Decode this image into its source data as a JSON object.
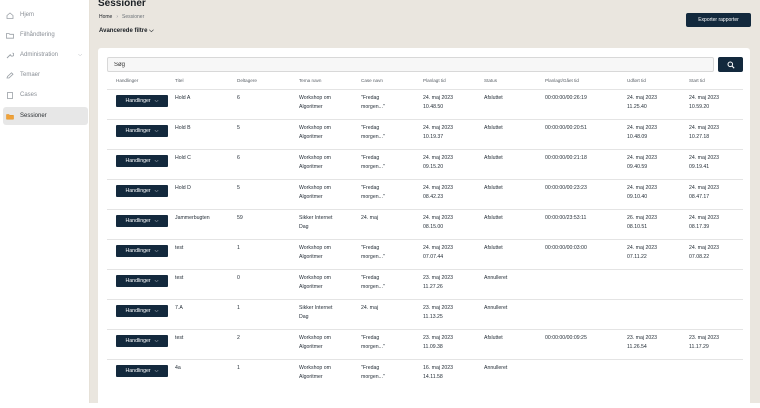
{
  "sidebar": {
    "items": [
      {
        "label": "Hjem",
        "icon": "home-icon"
      },
      {
        "label": "Filhåndtering",
        "icon": "folder-icon"
      },
      {
        "label": "Administration",
        "icon": "wrench-icon"
      },
      {
        "label": "Temaer",
        "icon": "pencil-icon"
      },
      {
        "label": "Cases",
        "icon": "document-icon"
      },
      {
        "label": "Sessioner",
        "icon": "folder-open-icon"
      }
    ]
  },
  "header": {
    "title": "Sessioner",
    "breadcrumb_home": "Home",
    "breadcrumb_current": "Sessioner",
    "advanced_filters": "Avancerede filtre",
    "export_button": "Exporter rapporter"
  },
  "search": {
    "value": "Søg",
    "icon": "search-icon"
  },
  "table": {
    "columns": [
      "Handlinger",
      "Titel",
      "Deltagere",
      "Tema navn",
      "Case navn",
      "Planlagt tid",
      "Status",
      "Planlagt/Gået tid",
      "Udført tid",
      "Start tid"
    ],
    "action_label": "Handlinger",
    "rows": [
      {
        "title": "Hold A",
        "participants": "6",
        "theme": [
          "Workshop om",
          "Algoritmer"
        ],
        "case": [
          "\"Fredag",
          "morgen...\""
        ],
        "planned": [
          "24. maj 2023",
          "10.48.50"
        ],
        "status": "Afsluttet",
        "elapsed": "00:00:00/00:26:19",
        "done": [
          "24. maj 2023",
          "11.25.40"
        ],
        "start": [
          "24. maj 2023",
          "10.59.20"
        ]
      },
      {
        "title": "Hold B",
        "participants": "5",
        "theme": [
          "Workshop om",
          "Algoritmer"
        ],
        "case": [
          "\"Fredag",
          "morgen...\""
        ],
        "planned": [
          "24. maj 2023",
          "10.19.37"
        ],
        "status": "Afsluttet",
        "elapsed": "00:00:00/00:20:51",
        "done": [
          "24. maj 2023",
          "10.48.09"
        ],
        "start": [
          "24. maj 2023",
          "10.27.18"
        ]
      },
      {
        "title": "Hold C",
        "participants": "6",
        "theme": [
          "Workshop om",
          "Algoritmer"
        ],
        "case": [
          "\"Fredag",
          "morgen...\""
        ],
        "planned": [
          "24. maj 2023",
          "09.15.20"
        ],
        "status": "Afsluttet",
        "elapsed": "00:00:00/00:21:18",
        "done": [
          "24. maj 2023",
          "09.40.59"
        ],
        "start": [
          "24. maj 2023",
          "09.19.41"
        ]
      },
      {
        "title": "Hold D",
        "participants": "5",
        "theme": [
          "Workshop om",
          "Algoritmer"
        ],
        "case": [
          "\"Fredag",
          "morgen...\""
        ],
        "planned": [
          "24. maj 2023",
          "08.42.23"
        ],
        "status": "Afsluttet",
        "elapsed": "00:00:00/00:23:23",
        "done": [
          "24. maj 2023",
          "09.10.40"
        ],
        "start": [
          "24. maj 2023",
          "08.47.17"
        ]
      },
      {
        "title": "Jammerbugten",
        "participants": "59",
        "theme": [
          "Sikker Internet",
          "Dag"
        ],
        "case": [
          "24. maj",
          ""
        ],
        "planned": [
          "24. maj 2023",
          "08.15.00"
        ],
        "status": "Afsluttet",
        "elapsed": "00:00:00/23:53:11",
        "done": [
          "26. maj 2023",
          "08.10.51"
        ],
        "start": [
          "24. maj 2023",
          "08.17.39"
        ]
      },
      {
        "title": "test",
        "participants": "1",
        "theme": [
          "Workshop om",
          "Algoritmer"
        ],
        "case": [
          "\"Fredag",
          "morgen...\""
        ],
        "planned": [
          "24. maj 2023",
          "07.07.44"
        ],
        "status": "Afsluttet",
        "elapsed": "00:00:00/00:03:00",
        "done": [
          "24. maj 2023",
          "07.11.22"
        ],
        "start": [
          "24. maj 2023",
          "07.08.22"
        ]
      },
      {
        "title": "test",
        "participants": "0",
        "theme": [
          "Workshop om",
          "Algoritmer"
        ],
        "case": [
          "\"Fredag",
          "morgen...\""
        ],
        "planned": [
          "23. maj 2023",
          "11.27.26"
        ],
        "status": "Annulleret",
        "elapsed": "",
        "done": [
          "",
          ""
        ],
        "start": [
          "",
          ""
        ]
      },
      {
        "title": "7.A",
        "participants": "1",
        "theme": [
          "Sikker Internet",
          "Dag"
        ],
        "case": [
          "24. maj",
          ""
        ],
        "planned": [
          "23. maj 2023",
          "11.13.25"
        ],
        "status": "Annulleret",
        "elapsed": "",
        "done": [
          "",
          ""
        ],
        "start": [
          "",
          ""
        ]
      },
      {
        "title": "test",
        "participants": "2",
        "theme": [
          "Workshop om",
          "Algoritmer"
        ],
        "case": [
          "\"Fredag",
          "morgen...\""
        ],
        "planned": [
          "23. maj 2023",
          "11.09.38"
        ],
        "status": "Afsluttet",
        "elapsed": "00:00:00/00:09:25",
        "done": [
          "23. maj 2023",
          "11.26.54"
        ],
        "start": [
          "23. maj 2023",
          "11.17.29"
        ]
      },
      {
        "title": "4a",
        "participants": "1",
        "theme": [
          "Workshop om",
          "Algoritmer"
        ],
        "case": [
          "\"Fredag",
          "morgen...\""
        ],
        "planned": [
          "16. maj 2023",
          "14.11.58"
        ],
        "status": "Annulleret",
        "elapsed": "",
        "done": [
          "",
          ""
        ],
        "start": [
          "",
          ""
        ]
      }
    ]
  },
  "colors": {
    "primary": "#13293d",
    "page_bg": "#eae6df",
    "sidebar_active": "#e7e7e7"
  }
}
